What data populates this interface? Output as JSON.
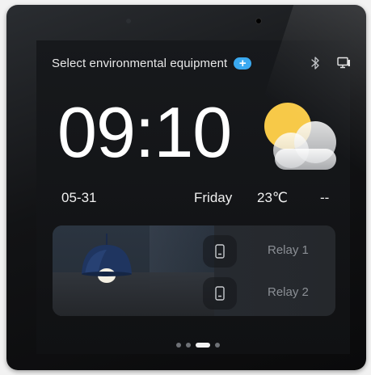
{
  "header": {
    "title": "Select environmental equipment",
    "add_label": "+",
    "bluetooth_icon": "bluetooth-icon",
    "network_icon": "network-screen-icon"
  },
  "clock": {
    "time": "09:10",
    "date": "05-31",
    "weekday": "Friday"
  },
  "weather": {
    "icon": "partly-cloudy-icon",
    "temperature": "23℃",
    "extra": "--"
  },
  "device_card": {
    "scene_icon": "pendant-lamp-image",
    "relays": [
      {
        "label": "Relay 1",
        "icon": "switch-icon"
      },
      {
        "label": "Relay 2",
        "icon": "switch-icon"
      }
    ]
  },
  "pager": {
    "count": 4,
    "active_index": 2
  },
  "colors": {
    "accent": "#3aa9f0",
    "sun": "#f7c948",
    "screen_bg": "#131416"
  }
}
